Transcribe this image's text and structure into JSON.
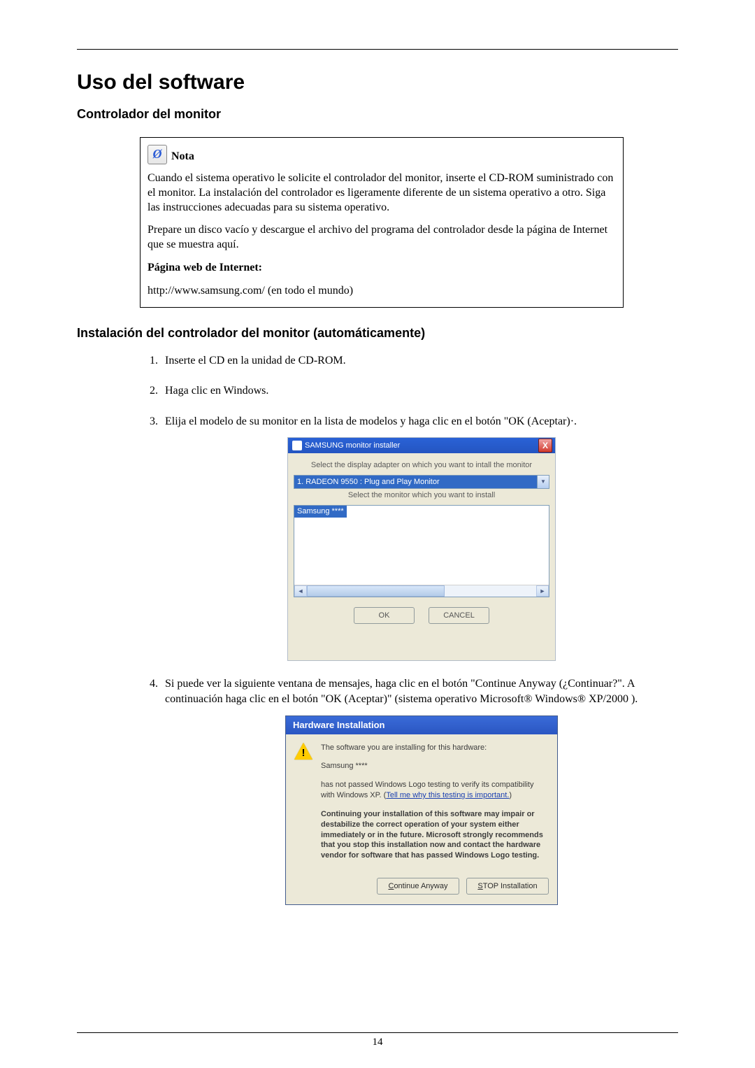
{
  "page_title": "Uso del software",
  "section_controller_heading": "Controlador del monitor",
  "note": {
    "title": "Nota",
    "p1": "Cuando el sistema operativo le solicite el controlador del monitor, inserte el CD-ROM suministrado con el monitor. La instalación del controlador es ligeramente diferente de un sistema operativo a otro. Siga las instrucciones adecuadas para su sistema operativo.",
    "p2": "Prepare un disco vacío y descargue el archivo del programa del controlador desde la página de Internet que se muestra aquí.",
    "web_label": "Página web de Internet:",
    "url": "http://www.samsung.com/ (en todo el mundo)"
  },
  "installation_heading": "Instalación del controlador del monitor (automáticamente)",
  "steps": {
    "s1": "Inserte el CD en la unidad de CD-ROM.",
    "s2": "Haga clic en Windows.",
    "s3": "Elija el modelo de su monitor en la lista de modelos y haga clic en el botón \"OK (Aceptar)·.",
    "s4": "Si puede ver la siguiente ventana de mensajes, haga clic en el botón \"Continue Anyway (¿Continuar?\". A continuación haga clic en el botón \"OK (Aceptar)\" (sistema operativo Microsoft® Windows® XP/2000 )."
  },
  "dlg_installer": {
    "title": "SAMSUNG monitor installer",
    "close": "X",
    "label_adapter": "Select the display adapter on which you want to intall the monitor",
    "adapter_selected": "1. RADEON 9550 : Plug and Play Monitor",
    "label_monitor": "Select the monitor which you want to install",
    "monitor_selected": "Samsung ****",
    "btn_ok": "OK",
    "btn_cancel": "CANCEL"
  },
  "dlg_hw": {
    "title": "Hardware Installation",
    "warn_mark": "!",
    "line1": "The software you are installing for this hardware:",
    "device": "Samsung ****",
    "line2a": "has not passed Windows Logo testing to verify its compatibility with Windows XP. (",
    "line2_link": "Tell me why this testing is important.",
    "line2b": ")",
    "bold_block": "Continuing your installation of this software may impair or destabilize the correct operation of your system either immediately or in the future. Microsoft strongly recommends that you stop this installation now and contact the hardware vendor for software that has passed Windows Logo testing.",
    "btn_continue": "Continue Anyway",
    "btn_stop": "STOP Installation"
  },
  "page_number": "14"
}
